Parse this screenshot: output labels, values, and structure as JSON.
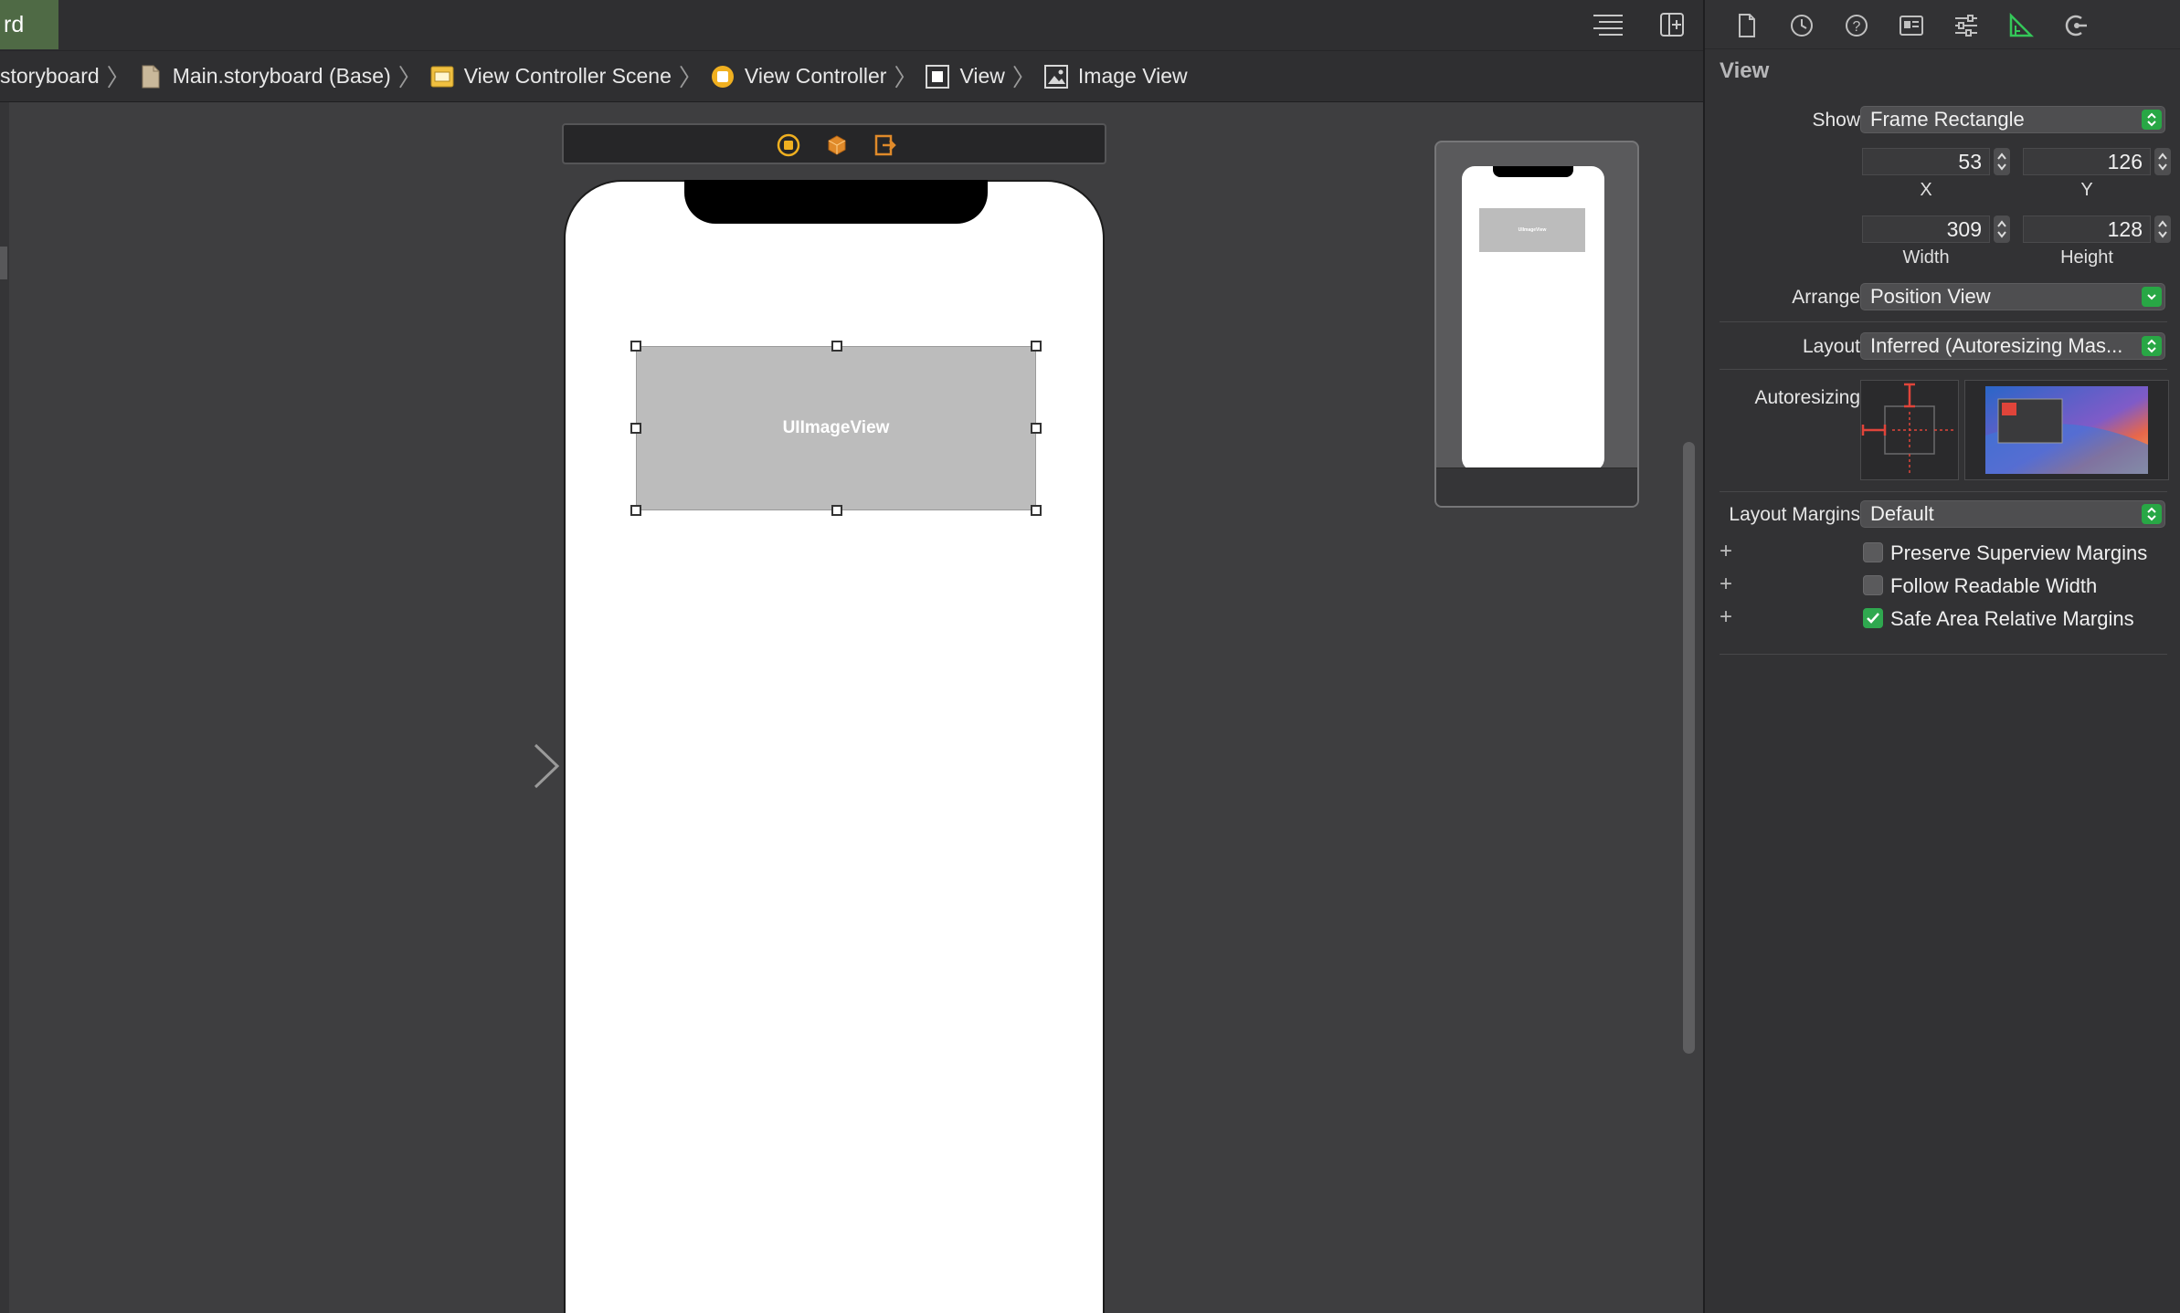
{
  "toolbar": {
    "tab_label": "rd",
    "list_icon": "list-lines-icon",
    "add_editor_icon": "add-editor-icon"
  },
  "breadcrumb": {
    "items": [
      {
        "label": "storyboard",
        "icon": ""
      },
      {
        "label": "Main.storyboard (Base)",
        "icon": "file-icon"
      },
      {
        "label": "View Controller Scene",
        "icon": "scene-icon"
      },
      {
        "label": "View Controller",
        "icon": "view-controller-icon"
      },
      {
        "label": "View",
        "icon": "view-icon"
      },
      {
        "label": "Image View",
        "icon": "image-view-icon"
      }
    ]
  },
  "canvas": {
    "image_view_label": "UIImageView",
    "mini_image_view_label": "UIImageView"
  },
  "inspector": {
    "section_title": "View",
    "show_label": "Show",
    "show_value": "Frame Rectangle",
    "x_value": "53",
    "y_value": "126",
    "width_value": "309",
    "height_value": "128",
    "x_caption": "X",
    "y_caption": "Y",
    "width_caption": "Width",
    "height_caption": "Height",
    "arrange_label": "Arrange",
    "arrange_value": "Position View",
    "layout_label": "Layout",
    "layout_value": "Inferred (Autoresizing Mas...",
    "autoresizing_label": "Autoresizing",
    "layout_margins_label": "Layout Margins",
    "layout_margins_value": "Default",
    "checkboxes": [
      {
        "label": "Preserve Superview Margins",
        "checked": false
      },
      {
        "label": "Follow Readable Width",
        "checked": false
      },
      {
        "label": "Safe Area Relative Margins",
        "checked": true
      }
    ]
  },
  "colors": {
    "accent_green": "#28a745",
    "scene_orange": "#f0a030",
    "autoresize_red": "#e0443a"
  }
}
